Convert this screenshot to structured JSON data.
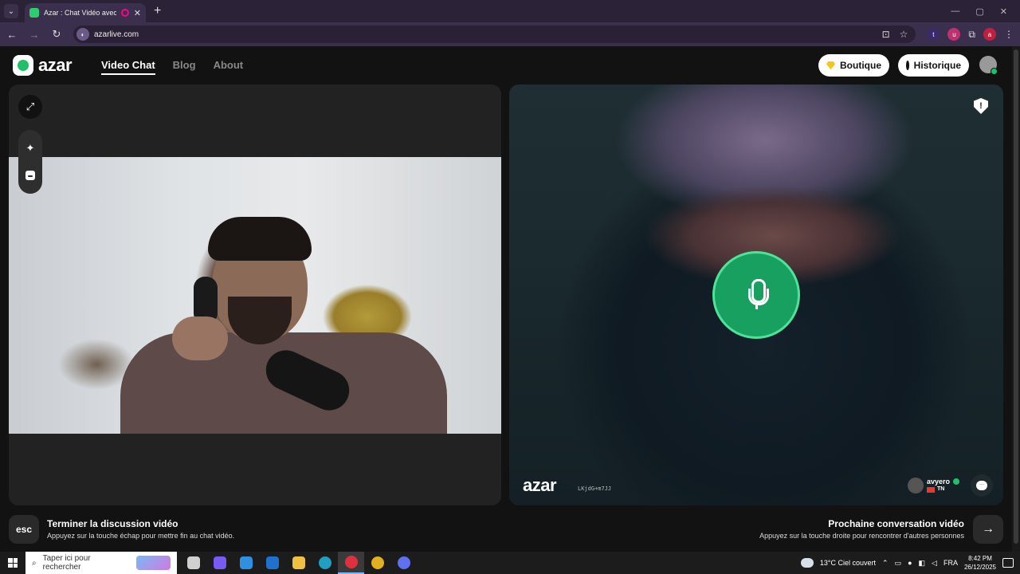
{
  "browser": {
    "tab_title": "Azar : Chat Vidéo avec de n",
    "tab_close": "✕",
    "new_tab": "+",
    "url": "azarlive.com",
    "ext_letters": [
      "t",
      "u",
      "a"
    ],
    "window_controls": [
      "—",
      "▢",
      "✕"
    ]
  },
  "site": {
    "logo_text": "azar",
    "nav": {
      "video_chat": "Video Chat",
      "blog": "Blog",
      "about": "About"
    },
    "boutique_label": "Boutique",
    "historique_label": "Historique"
  },
  "remote": {
    "watermark": "azar",
    "session_id": "LKjdG+m7JJ",
    "peer_name": "avyero",
    "peer_country": "TN"
  },
  "controls": {
    "end_key": "esc",
    "end_title": "Terminer la discussion vidéo",
    "end_subtitle": "Appuyez sur la touche échap pour mettre fin au chat vidéo.",
    "next_key": "→",
    "next_title": "Prochaine conversation vidéo",
    "next_subtitle": "Appuyez sur la touche droite pour rencontrer d'autres personnes"
  },
  "taskbar": {
    "search_placeholder": "Taper ici pour rechercher",
    "weather": "13°C  Ciel couvert",
    "language": "FRA",
    "time": "8:42 PM",
    "date": "26/12/2025",
    "app_colors": [
      "#d0d0d0",
      "#7a5af5",
      "#2f8fe0",
      "#2070d0",
      "#f0c040",
      "#20a0c0",
      "#e03040",
      "#e0b020",
      "#6070f0"
    ]
  },
  "colors": {
    "accent_green": "#17a060",
    "boutique_gem": "#f5c518"
  }
}
